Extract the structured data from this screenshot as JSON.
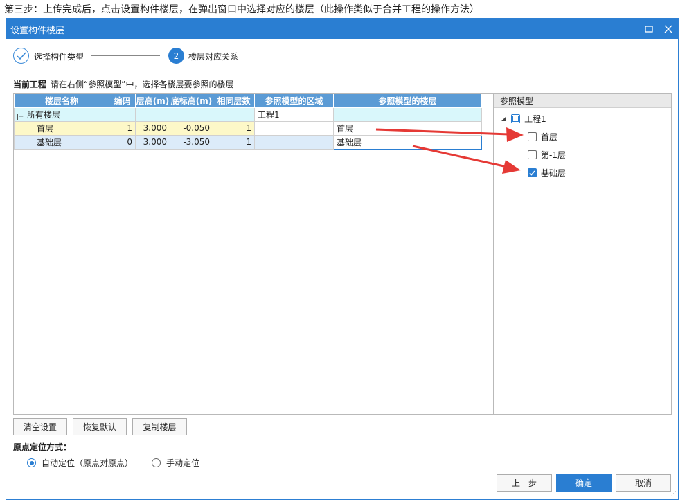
{
  "caption": "第三步：上传完成后，点击设置构件楼层，在弹出窗口中选择对应的楼层（此操作类似于合并工程的操作方法）",
  "dialog": {
    "title": "设置构件楼层",
    "maximize_icon": "maximize-icon",
    "close_icon": "close-icon"
  },
  "steps": {
    "step1_label": "选择构件类型",
    "step2_number": "2",
    "step2_label": "楼层对应关系"
  },
  "info": {
    "bold": "当前工程",
    "text": "请在右侧“参照模型”中，选择各楼层要参照的楼层"
  },
  "table": {
    "columns": [
      "楼层名称",
      "编码",
      "层高(m)",
      "底标高(m)",
      "相同层数",
      "参照模型的区域",
      "参照模型的楼层"
    ],
    "group_row": {
      "name": "所有楼层",
      "expander": "−",
      "region": "工程1",
      "ref_floor": ""
    },
    "rows": [
      {
        "name": "首层",
        "code": "1",
        "height": "3.000",
        "bottom": "-0.050",
        "same": "1",
        "region": "",
        "ref_floor": "首层"
      },
      {
        "name": "基础层",
        "code": "0",
        "height": "3.000",
        "bottom": "-3.050",
        "same": "1",
        "region": "",
        "ref_floor": "基础层"
      }
    ]
  },
  "ref_model": {
    "header": "参照模型",
    "root": {
      "label": "工程1",
      "expand_icon": "triangle-down-icon",
      "state": "partial"
    },
    "items": [
      {
        "label": "首层",
        "checked": false
      },
      {
        "label": "第-1层",
        "checked": false
      },
      {
        "label": "基础层",
        "checked": true
      }
    ]
  },
  "buttons": {
    "clear": "清空设置",
    "restore": "恢复默认",
    "copy": "复制楼层",
    "prev": "上一步",
    "ok": "确定",
    "cancel": "取消"
  },
  "origin": {
    "label": "原点定位方式：",
    "auto": "自动定位（原点对原点）",
    "manual": "手动定位",
    "selected": "auto"
  },
  "colors": {
    "accent": "#2a7ed2",
    "header_blue": "#5b9bd5",
    "annotation_red": "#e53935"
  }
}
